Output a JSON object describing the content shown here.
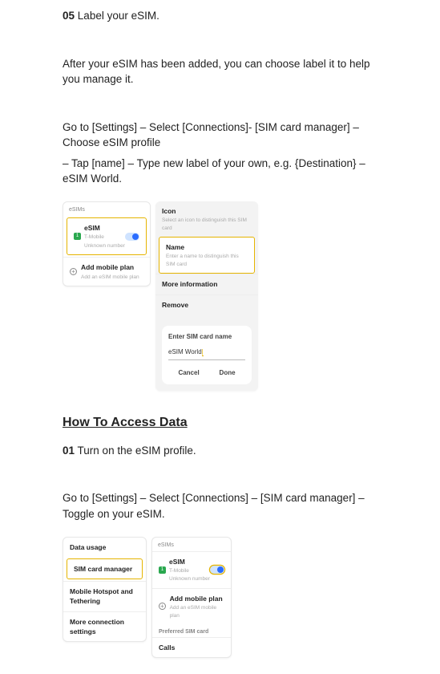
{
  "step05": {
    "num": "05",
    "label": "Label your eSIM."
  },
  "p1": "After your eSIM has been added, you can choose label it to help you manage it.",
  "p2": "Go to [Settings] – Select [Connections]- [SIM card manager] – Choose eSIM profile",
  "p3": "– Tap [name] – Type new label of your own, e.g. {Destination} – eSIM World.",
  "shot1": {
    "left": {
      "hdr": "eSIMs",
      "esim_title": "eSIM",
      "esim_sub1": "T-Mobile",
      "esim_sub2": "Unknown number",
      "indicator": "1",
      "add_title": "Add mobile plan",
      "add_sub": "Add an eSIM mobile plan"
    },
    "right": {
      "icon_title": "Icon",
      "icon_sub": "Select an icon to distinguish this SIM card",
      "name_title": "Name",
      "name_sub": "Enter a name to distinguish this SIM card",
      "more": "More information",
      "remove": "Remove",
      "dlg_title": "Enter SIM card name",
      "dlg_value": "eSIM World",
      "cancel": "Cancel",
      "done": "Done"
    }
  },
  "section": "How To Access Data",
  "step01": {
    "num": "01",
    "label": "Turn on the eSIM profile."
  },
  "p4": "Go to [Settings] – Select [Connections] – [SIM card manager] – Toggle on your eSIM.",
  "shot2": {
    "left": {
      "r1": "Data usage",
      "r2": "SIM card manager",
      "r3": "Mobile Hotspot and Tethering",
      "r4": "More connection settings"
    },
    "right": {
      "hdr": "eSIMs",
      "esim_title": "eSIM",
      "esim_sub1": "T-Mobile",
      "esim_sub2": "Unknown number",
      "indicator": "1",
      "add_title": "Add mobile plan",
      "add_sub": "Add an eSIM mobile plan",
      "pref": "Preferred SIM card",
      "calls": "Calls"
    }
  }
}
